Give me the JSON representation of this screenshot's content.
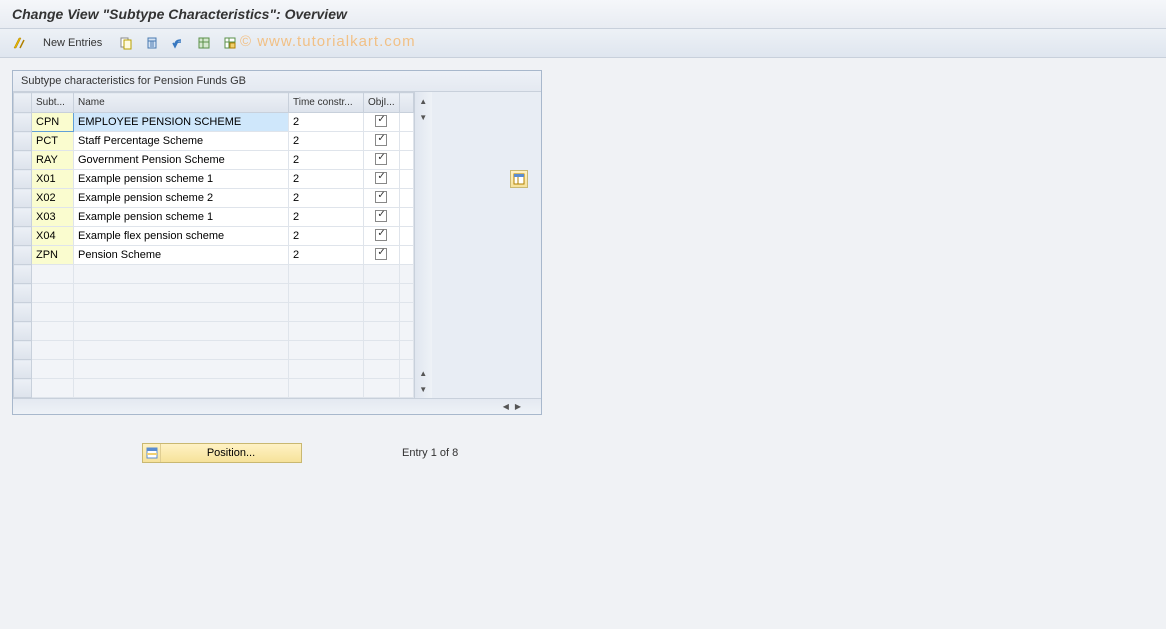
{
  "title": "Change View \"Subtype Characteristics\": Overview",
  "toolbar": {
    "new_entries_label": "New Entries"
  },
  "watermark": "© www.tutorialkart.com",
  "panel_title": "Subtype characteristics for Pension Funds  GB",
  "columns": {
    "sub": "Subt...",
    "name": "Name",
    "tc": "Time constr...",
    "obj": "ObjI..."
  },
  "rows": [
    {
      "sub": "CPN",
      "name": "EMPLOYEE PENSION SCHEME",
      "tc": "2",
      "obj": true,
      "highlighted": true
    },
    {
      "sub": "PCT",
      "name": "Staff Percentage Scheme",
      "tc": "2",
      "obj": true,
      "highlighted": false
    },
    {
      "sub": "RAY",
      "name": "Government Pension Scheme",
      "tc": "2",
      "obj": true,
      "highlighted": false
    },
    {
      "sub": "X01",
      "name": "Example pension scheme 1",
      "tc": "2",
      "obj": true,
      "highlighted": false
    },
    {
      "sub": "X02",
      "name": "Example pension scheme 2",
      "tc": "2",
      "obj": true,
      "highlighted": false
    },
    {
      "sub": "X03",
      "name": "Example pension scheme 1",
      "tc": "2",
      "obj": true,
      "highlighted": false
    },
    {
      "sub": "X04",
      "name": "Example flex pension scheme",
      "tc": "2",
      "obj": true,
      "highlighted": false
    },
    {
      "sub": "ZPN",
      "name": "Pension Scheme",
      "tc": "2",
      "obj": true,
      "highlighted": false
    }
  ],
  "empty_row_count": 7,
  "position_label": "Position...",
  "entry_status": "Entry 1 of 8"
}
